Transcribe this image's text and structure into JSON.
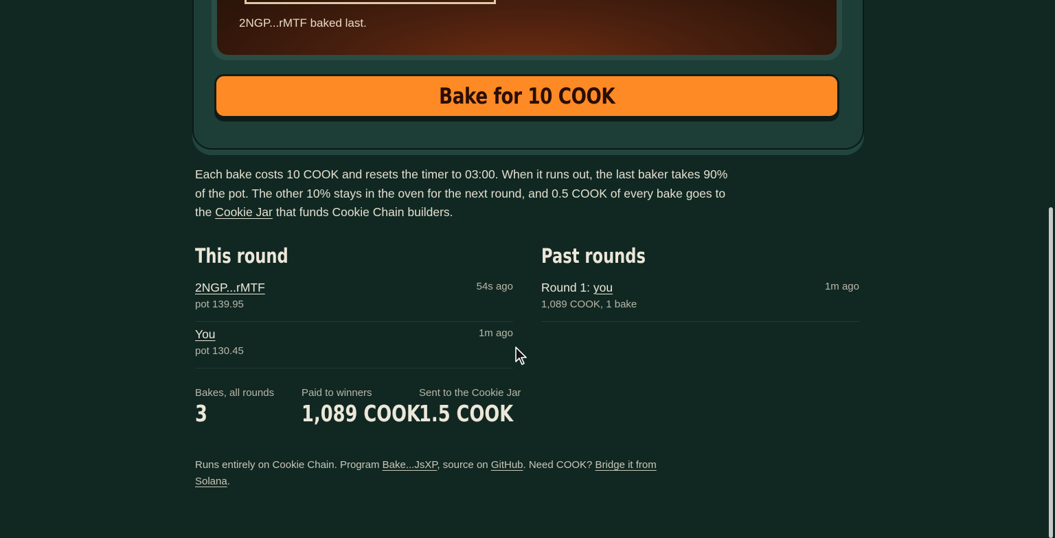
{
  "oven": {
    "last_baker_text": "2NGP...rMTF baked last."
  },
  "bake_button": {
    "label": "Bake for 10 COOK"
  },
  "description": {
    "part1": "Each bake costs 10 COOK and resets the timer to 03:00. When it runs out, the last baker takes 90% of the pot. The other 10% stays in the oven for the next round, and 0.5 COOK of every bake goes to the ",
    "link": "Cookie Jar",
    "part2": " that funds Cookie Chain builders."
  },
  "this_round": {
    "title": "This round",
    "entries": [
      {
        "who": "2NGP...rMTF",
        "detail": "pot 139.95",
        "time": "54s ago"
      },
      {
        "who": "You",
        "detail": "pot 130.45",
        "time": "1m ago"
      }
    ]
  },
  "past_rounds": {
    "title": "Past rounds",
    "entries": [
      {
        "prefix": "Round 1: ",
        "who": "you",
        "detail": "1,089 COOK, 1 bake",
        "time": "1m ago"
      }
    ]
  },
  "stats": [
    {
      "label": "Bakes, all rounds",
      "value": "3"
    },
    {
      "label": "Paid to winners",
      "value": "1,089 COOK"
    },
    {
      "label": "Sent to the Cookie Jar",
      "value": "1.5 COOK"
    }
  ],
  "footer": {
    "t1": "Runs entirely on Cookie Chain. Program ",
    "program_link": "Bake...JsXP",
    "t2": ", source on ",
    "github_link": "GitHub",
    "t3": ". Need COOK? ",
    "bridge_link": "Bridge it from Solana",
    "t4": "."
  }
}
